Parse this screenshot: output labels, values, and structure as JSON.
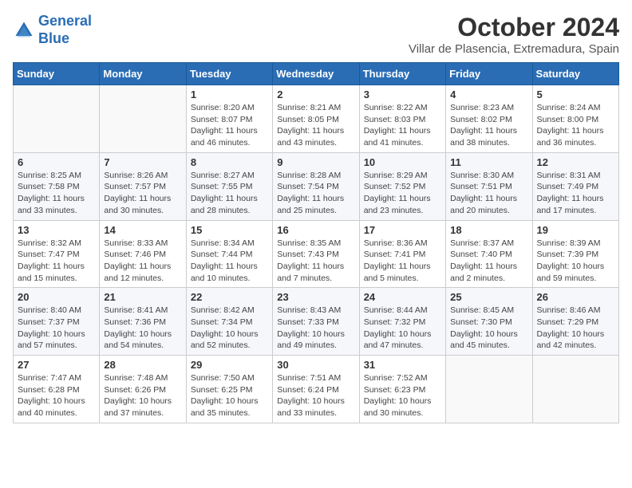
{
  "header": {
    "logo_line1": "General",
    "logo_line2": "Blue",
    "month_title": "October 2024",
    "location": "Villar de Plasencia, Extremadura, Spain"
  },
  "days_of_week": [
    "Sunday",
    "Monday",
    "Tuesday",
    "Wednesday",
    "Thursday",
    "Friday",
    "Saturday"
  ],
  "weeks": [
    [
      {
        "day": "",
        "info": ""
      },
      {
        "day": "",
        "info": ""
      },
      {
        "day": "1",
        "info": "Sunrise: 8:20 AM\nSunset: 8:07 PM\nDaylight: 11 hours and 46 minutes."
      },
      {
        "day": "2",
        "info": "Sunrise: 8:21 AM\nSunset: 8:05 PM\nDaylight: 11 hours and 43 minutes."
      },
      {
        "day": "3",
        "info": "Sunrise: 8:22 AM\nSunset: 8:03 PM\nDaylight: 11 hours and 41 minutes."
      },
      {
        "day": "4",
        "info": "Sunrise: 8:23 AM\nSunset: 8:02 PM\nDaylight: 11 hours and 38 minutes."
      },
      {
        "day": "5",
        "info": "Sunrise: 8:24 AM\nSunset: 8:00 PM\nDaylight: 11 hours and 36 minutes."
      }
    ],
    [
      {
        "day": "6",
        "info": "Sunrise: 8:25 AM\nSunset: 7:58 PM\nDaylight: 11 hours and 33 minutes."
      },
      {
        "day": "7",
        "info": "Sunrise: 8:26 AM\nSunset: 7:57 PM\nDaylight: 11 hours and 30 minutes."
      },
      {
        "day": "8",
        "info": "Sunrise: 8:27 AM\nSunset: 7:55 PM\nDaylight: 11 hours and 28 minutes."
      },
      {
        "day": "9",
        "info": "Sunrise: 8:28 AM\nSunset: 7:54 PM\nDaylight: 11 hours and 25 minutes."
      },
      {
        "day": "10",
        "info": "Sunrise: 8:29 AM\nSunset: 7:52 PM\nDaylight: 11 hours and 23 minutes."
      },
      {
        "day": "11",
        "info": "Sunrise: 8:30 AM\nSunset: 7:51 PM\nDaylight: 11 hours and 20 minutes."
      },
      {
        "day": "12",
        "info": "Sunrise: 8:31 AM\nSunset: 7:49 PM\nDaylight: 11 hours and 17 minutes."
      }
    ],
    [
      {
        "day": "13",
        "info": "Sunrise: 8:32 AM\nSunset: 7:47 PM\nDaylight: 11 hours and 15 minutes."
      },
      {
        "day": "14",
        "info": "Sunrise: 8:33 AM\nSunset: 7:46 PM\nDaylight: 11 hours and 12 minutes."
      },
      {
        "day": "15",
        "info": "Sunrise: 8:34 AM\nSunset: 7:44 PM\nDaylight: 11 hours and 10 minutes."
      },
      {
        "day": "16",
        "info": "Sunrise: 8:35 AM\nSunset: 7:43 PM\nDaylight: 11 hours and 7 minutes."
      },
      {
        "day": "17",
        "info": "Sunrise: 8:36 AM\nSunset: 7:41 PM\nDaylight: 11 hours and 5 minutes."
      },
      {
        "day": "18",
        "info": "Sunrise: 8:37 AM\nSunset: 7:40 PM\nDaylight: 11 hours and 2 minutes."
      },
      {
        "day": "19",
        "info": "Sunrise: 8:39 AM\nSunset: 7:39 PM\nDaylight: 10 hours and 59 minutes."
      }
    ],
    [
      {
        "day": "20",
        "info": "Sunrise: 8:40 AM\nSunset: 7:37 PM\nDaylight: 10 hours and 57 minutes."
      },
      {
        "day": "21",
        "info": "Sunrise: 8:41 AM\nSunset: 7:36 PM\nDaylight: 10 hours and 54 minutes."
      },
      {
        "day": "22",
        "info": "Sunrise: 8:42 AM\nSunset: 7:34 PM\nDaylight: 10 hours and 52 minutes."
      },
      {
        "day": "23",
        "info": "Sunrise: 8:43 AM\nSunset: 7:33 PM\nDaylight: 10 hours and 49 minutes."
      },
      {
        "day": "24",
        "info": "Sunrise: 8:44 AM\nSunset: 7:32 PM\nDaylight: 10 hours and 47 minutes."
      },
      {
        "day": "25",
        "info": "Sunrise: 8:45 AM\nSunset: 7:30 PM\nDaylight: 10 hours and 45 minutes."
      },
      {
        "day": "26",
        "info": "Sunrise: 8:46 AM\nSunset: 7:29 PM\nDaylight: 10 hours and 42 minutes."
      }
    ],
    [
      {
        "day": "27",
        "info": "Sunrise: 7:47 AM\nSunset: 6:28 PM\nDaylight: 10 hours and 40 minutes."
      },
      {
        "day": "28",
        "info": "Sunrise: 7:48 AM\nSunset: 6:26 PM\nDaylight: 10 hours and 37 minutes."
      },
      {
        "day": "29",
        "info": "Sunrise: 7:50 AM\nSunset: 6:25 PM\nDaylight: 10 hours and 35 minutes."
      },
      {
        "day": "30",
        "info": "Sunrise: 7:51 AM\nSunset: 6:24 PM\nDaylight: 10 hours and 33 minutes."
      },
      {
        "day": "31",
        "info": "Sunrise: 7:52 AM\nSunset: 6:23 PM\nDaylight: 10 hours and 30 minutes."
      },
      {
        "day": "",
        "info": ""
      },
      {
        "day": "",
        "info": ""
      }
    ]
  ]
}
